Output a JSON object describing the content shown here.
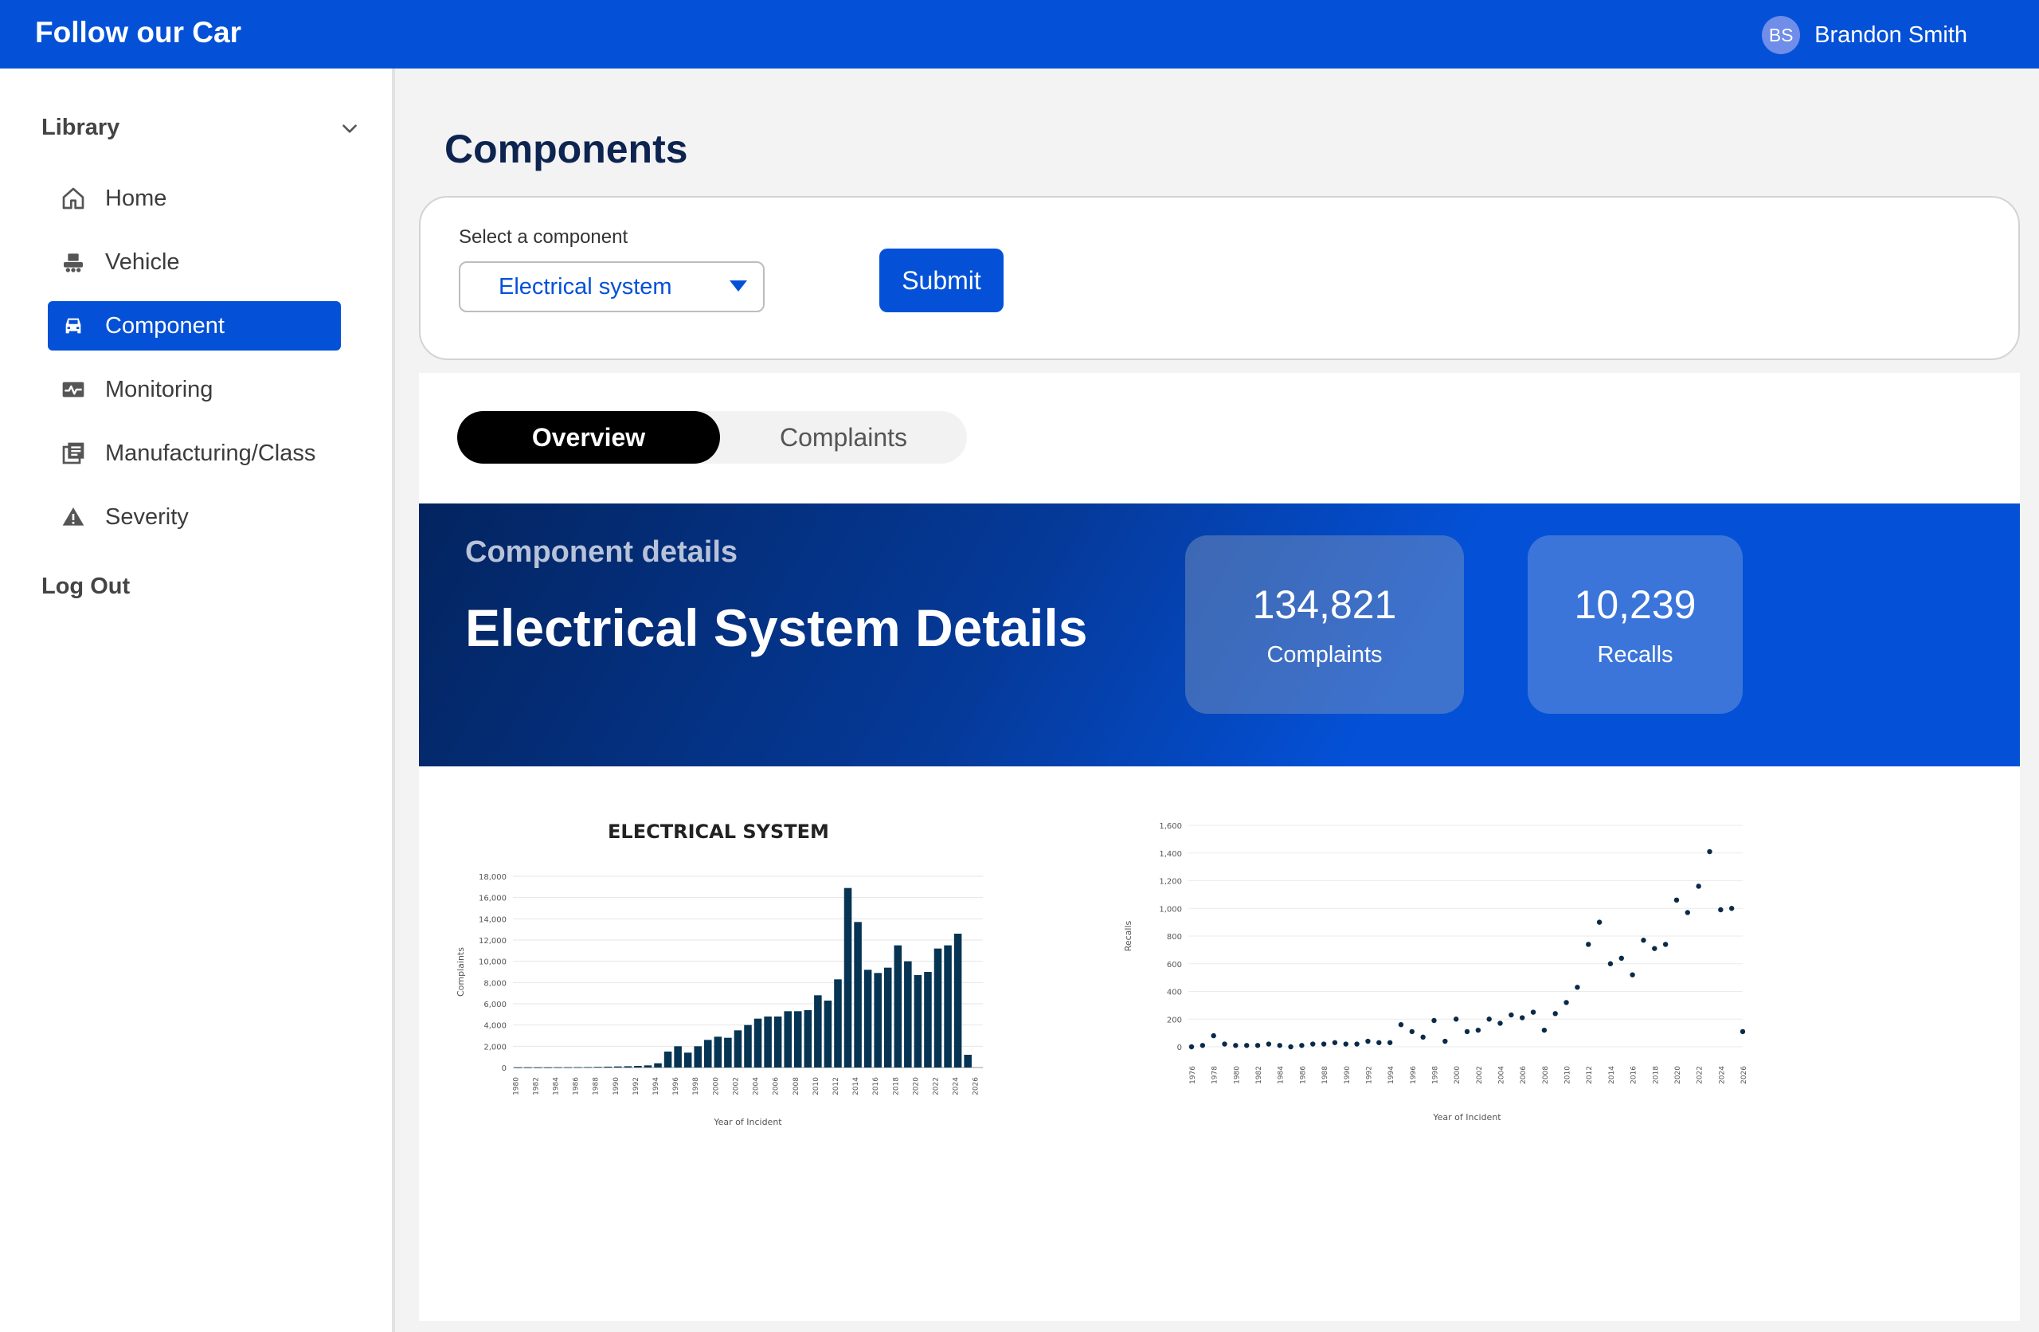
{
  "app": {
    "brand": "Follow our Car"
  },
  "user": {
    "initials": "BS",
    "name": "Brandon Smith"
  },
  "sidebar": {
    "section_title": "Library",
    "items": [
      {
        "label": "Home",
        "icon": "home-icon"
      },
      {
        "label": "Vehicle",
        "icon": "vehicle-icon"
      },
      {
        "label": "Component",
        "icon": "car-icon",
        "active": true
      },
      {
        "label": "Monitoring",
        "icon": "monitor-icon"
      },
      {
        "label": "Manufacturing/Class",
        "icon": "library-icon"
      },
      {
        "label": "Severity",
        "icon": "warning-icon"
      }
    ],
    "logout_label": "Log Out"
  },
  "main": {
    "page_title": "Components",
    "select": {
      "label": "Select a component",
      "value": "Electrical system"
    },
    "submit_label": "Submit",
    "tabs": [
      {
        "label": "Overview",
        "active": true
      },
      {
        "label": "Complaints",
        "active": false
      }
    ],
    "banner": {
      "subtitle": "Component details",
      "title": "Electrical System Details",
      "stats": [
        {
          "value": "134,821",
          "label": "Complaints"
        },
        {
          "value": "10,239",
          "label": "Recalls"
        }
      ]
    }
  },
  "colors": {
    "primary": "#0451d8",
    "bar": "#063452",
    "dot": "#0b2a4a"
  },
  "chart_data": [
    {
      "type": "bar",
      "title": "ELECTRICAL SYSTEM",
      "xlabel": "Year of Incident",
      "ylabel": "Complaints",
      "ylim": [
        0,
        18000
      ],
      "yticks": [
        "0",
        "2,000",
        "4,000",
        "6,000",
        "8,000",
        "10,000",
        "12,000",
        "14,000",
        "16,000",
        "18,000"
      ],
      "xticks": [
        "1980",
        "1982",
        "1984",
        "1986",
        "1988",
        "1990",
        "1992",
        "1994",
        "1996",
        "1998",
        "2000",
        "2002",
        "2004",
        "2006",
        "2008",
        "2010",
        "2012",
        "2014",
        "2016",
        "2018",
        "2020",
        "2022",
        "2024",
        "2026"
      ],
      "categories": [
        "1980",
        "1981",
        "1982",
        "1983",
        "1984",
        "1985",
        "1986",
        "1987",
        "1988",
        "1989",
        "1990",
        "1991",
        "1992",
        "1993",
        "1994",
        "1995",
        "1996",
        "1997",
        "1998",
        "1999",
        "2000",
        "2001",
        "2002",
        "2003",
        "2004",
        "2005",
        "2006",
        "2007",
        "2008",
        "2009",
        "2010",
        "2011",
        "2012",
        "2013",
        "2014",
        "2015",
        "2016",
        "2017",
        "2018",
        "2019",
        "2020",
        "2021",
        "2022",
        "2023",
        "2024",
        "2025",
        "2026"
      ],
      "values": [
        10,
        10,
        10,
        10,
        20,
        20,
        30,
        40,
        60,
        80,
        100,
        120,
        150,
        200,
        400,
        1500,
        2000,
        1400,
        2000,
        2600,
        2900,
        2800,
        3500,
        4000,
        4600,
        4800,
        4800,
        5300,
        5300,
        5400,
        6800,
        6300,
        8300,
        16900,
        13700,
        9200,
        8900,
        9400,
        11500,
        10000,
        8700,
        9000,
        11200,
        11500,
        12600,
        1200
      ]
    },
    {
      "type": "scatter",
      "title": "",
      "xlabel": "Year of Incident",
      "ylabel": "Recalls",
      "ylim": [
        0,
        1600
      ],
      "yticks": [
        "0",
        "200",
        "400",
        "600",
        "800",
        "1,000",
        "1,200",
        "1,400",
        "1,600"
      ],
      "xticks": [
        "1976",
        "1978",
        "1980",
        "1982",
        "1984",
        "1986",
        "1988",
        "1990",
        "1992",
        "1994",
        "1996",
        "1998",
        "2000",
        "2002",
        "2004",
        "2006",
        "2008",
        "2010",
        "2012",
        "2014",
        "2016",
        "2018",
        "2020",
        "2022",
        "2024",
        "2026"
      ],
      "x": [
        1976,
        1977,
        1978,
        1979,
        1980,
        1981,
        1982,
        1983,
        1984,
        1985,
        1986,
        1987,
        1988,
        1989,
        1990,
        1991,
        1992,
        1993,
        1994,
        1995,
        1996,
        1997,
        1998,
        1999,
        2000,
        2001,
        2002,
        2003,
        2004,
        2005,
        2006,
        2007,
        2008,
        2009,
        2010,
        2011,
        2012,
        2013,
        2014,
        2015,
        2016,
        2017,
        2018,
        2019,
        2020,
        2021,
        2022,
        2023,
        2024,
        2025,
        2026
      ],
      "y": [
        0,
        10,
        80,
        20,
        10,
        10,
        10,
        20,
        10,
        0,
        10,
        20,
        20,
        30,
        20,
        20,
        40,
        30,
        30,
        160,
        110,
        70,
        190,
        40,
        200,
        110,
        120,
        200,
        170,
        230,
        210,
        250,
        120,
        240,
        320,
        430,
        740,
        900,
        600,
        640,
        520,
        770,
        710,
        740,
        1060,
        970,
        1160,
        1410,
        990,
        1000,
        110
      ]
    }
  ]
}
